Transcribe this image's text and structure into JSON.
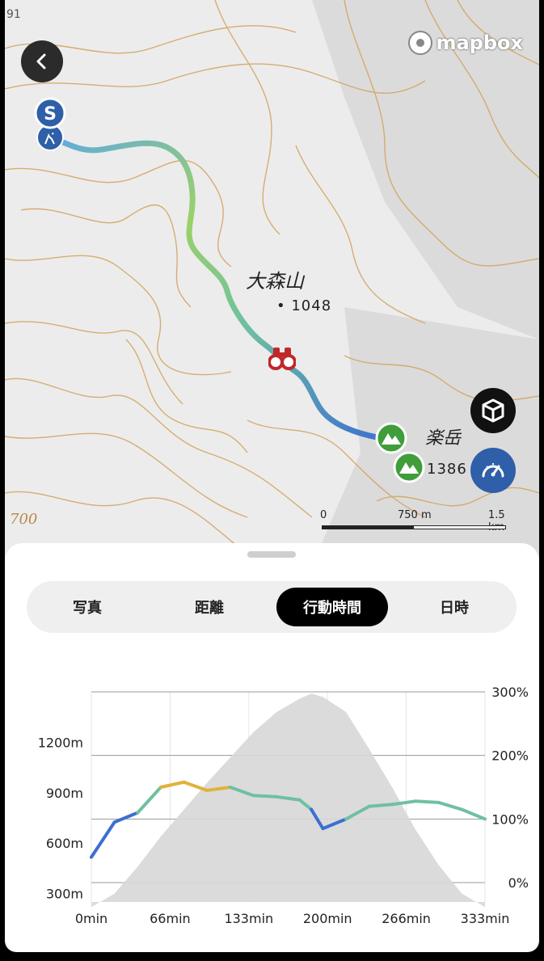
{
  "map": {
    "corner_label": "91",
    "attribution": "mapbox",
    "peak_name": "大森山",
    "peak_elevation": "1048",
    "summit_name_partial": "楽岳",
    "summit_elevation": "1386",
    "contour_label": "700",
    "start_marker": "S",
    "scale": {
      "left": "0",
      "mid": "750 m",
      "right": "1.5 km"
    },
    "icons": {
      "back": "chevron-left-icon",
      "view_3d": "cube-icon",
      "speed": "speedometer-icon",
      "viewpoint": "binoculars-icon",
      "summit": "mountain-icon",
      "start": "start-marker-icon"
    }
  },
  "tabs": [
    {
      "label": "写真",
      "active": false
    },
    {
      "label": "距離",
      "active": false
    },
    {
      "label": "行動時間",
      "active": true
    },
    {
      "label": "日時",
      "active": false
    }
  ],
  "chart_data": {
    "type": "area",
    "x": [
      0,
      20,
      40,
      60,
      80,
      100,
      120,
      140,
      160,
      180,
      190,
      200,
      220,
      240,
      260,
      280,
      300,
      320,
      340
    ],
    "elevation_m": [
      220,
      300,
      460,
      640,
      800,
      960,
      1110,
      1260,
      1380,
      1460,
      1490,
      1470,
      1380,
      1160,
      930,
      680,
      470,
      300,
      220
    ],
    "speed_pct": [
      40,
      95,
      110,
      150,
      158,
      145,
      150,
      137,
      135,
      130,
      115,
      85,
      100,
      120,
      123,
      128,
      126,
      115,
      100
    ],
    "x_ticks": [
      "0min",
      "66min",
      "133min",
      "200min",
      "266min",
      "333min"
    ],
    "y_left_ticks": [
      "300m",
      "600m",
      "900m",
      "1200m"
    ],
    "y_right_ticks": [
      "0%",
      "100%",
      "200%",
      "300%"
    ],
    "ylim_left": [
      250,
      1500
    ],
    "ylim_right": [
      0,
      300
    ],
    "grid": true,
    "colors": {
      "elevation_fill": "#d7d7d7",
      "speed_low": "#3b6fd1",
      "speed_mid": "#6fc0a0",
      "speed_high": "#e0b23a"
    }
  }
}
